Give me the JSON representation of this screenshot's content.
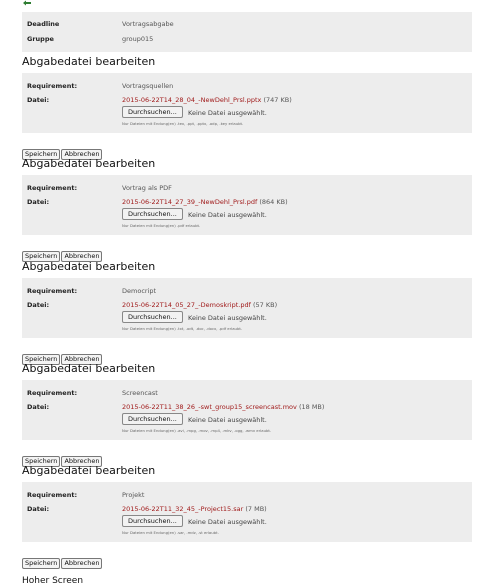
{
  "info": {
    "deadline_label": "Deadline",
    "deadline_value": "Vortragsabgabe",
    "group_label": "Gruppe",
    "group_value": "group015"
  },
  "sections": [
    {
      "title": "Abgabedatei bearbeiten",
      "requirement_label": "Requirement:",
      "requirement_value": "Vortragsquellen",
      "file_label": "Datei:",
      "file_name": "2015-06-22T14_28_04_-NewDehl_Prsl.pptx",
      "file_size": "(747 KB)",
      "browse_label": "Durchsuchen...",
      "no_file_text": "Keine Datei ausgewählt.",
      "hint": "Nur Dateien mit Endung(en) .tex, .ppt, .pptx, .odp, .key erlaubt.",
      "save_label": "Speichern",
      "cancel_label": "Abbrechen"
    },
    {
      "title": "Abgabedatei bearbeiten",
      "requirement_label": "Requirement:",
      "requirement_value": "Vortrag als PDF",
      "file_label": "Datei:",
      "file_name": "2015-06-22T14_27_39_-NewDehl_Prsl.pdf",
      "file_size": "(864 KB)",
      "browse_label": "Durchsuchen...",
      "no_file_text": "Keine Datei ausgewählt.",
      "hint": "Nur Dateien mit Endung(en) .pdf erlaubt.",
      "save_label": "Speichern",
      "cancel_label": "Abbrechen"
    },
    {
      "title": "Abgabedatei bearbeiten",
      "requirement_label": "Requirement:",
      "requirement_value": "Democript",
      "file_label": "Datei:",
      "file_name": "2015-06-22T14_05_27_-Demoskript.pdf",
      "file_size": "(57 KB)",
      "browse_label": "Durchsuchen...",
      "no_file_text": "Keine Datei ausgewählt.",
      "hint": "Nur Dateien mit Endung(en) .txt, .odt, .doc, .docx, .pdf erlaubt.",
      "save_label": "Speichern",
      "cancel_label": "Abbrechen"
    },
    {
      "title": "Abgabedatei bearbeiten",
      "requirement_label": "Requirement:",
      "requirement_value": "Screencast",
      "file_label": "Datei:",
      "file_name": "2015-06-22T11_38_26_-swt_group15_screencast.mov",
      "file_size": "(18 MB)",
      "browse_label": "Durchsuchen...",
      "no_file_text": "Keine Datei ausgewählt.",
      "hint": "Nur Dateien mit Endung(en) .avi, .mpg, .mov, .mp4, .mkv, .ogg, .wmv erlaubt.",
      "save_label": "Speichern",
      "cancel_label": "Abbrechen"
    },
    {
      "title": "Abgabedatei bearbeiten",
      "requirement_label": "Requirement:",
      "requirement_value": "Projekt",
      "file_label": "Datei:",
      "file_name": "2015-06-22T11_32_45_-Project15.sar",
      "file_size": "(7 MB)",
      "browse_label": "Durchsuchen...",
      "no_file_text": "Keine Datei ausgewählt.",
      "hint": "Nur Dateien mit Endung(en) .sar, .mdz, .st erlaubt.",
      "save_label": "Speichern",
      "cancel_label": "Abbrechen"
    }
  ],
  "footer": {
    "heading": "Hoher Screen"
  },
  "colors": {
    "panel_bg": "#ededed",
    "file_link": "#a01a1a",
    "back_arrow": "#2e7d32"
  }
}
